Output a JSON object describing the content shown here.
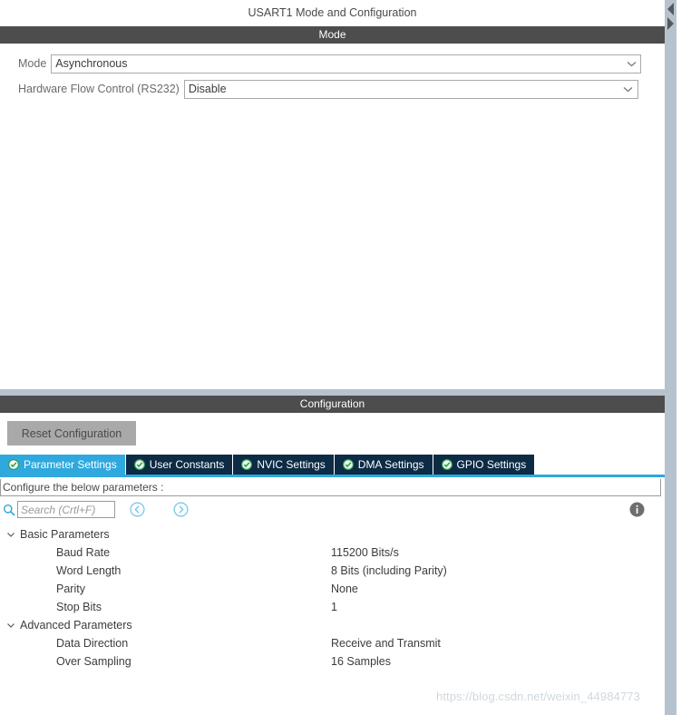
{
  "window": {
    "title": "USART1 Mode and Configuration"
  },
  "mode_section": {
    "header": "Mode",
    "fields": [
      {
        "label": "Mode",
        "value": "Asynchronous",
        "icon": "chevron-down-icon"
      },
      {
        "label": "Hardware Flow Control (RS232)",
        "value": "Disable",
        "icon": "chevron-down-icon"
      }
    ]
  },
  "configuration_section": {
    "header": "Configuration",
    "reset_button": "Reset Configuration",
    "tabs": [
      {
        "label": "Parameter Settings",
        "active": true,
        "icon": "green-check-icon"
      },
      {
        "label": "User Constants",
        "active": false,
        "icon": "green-check-icon"
      },
      {
        "label": "NVIC Settings",
        "active": false,
        "icon": "green-check-icon"
      },
      {
        "label": "DMA Settings",
        "active": false,
        "icon": "green-check-icon"
      },
      {
        "label": "GPIO Settings",
        "active": false,
        "icon": "green-check-icon"
      }
    ],
    "configure_label": "Configure the below parameters :",
    "search": {
      "placeholder": "Search (Crtl+F)",
      "value": "",
      "icon": "search-icon"
    },
    "nav": {
      "prev_icon": "circle-arrow-left-icon",
      "next_icon": "circle-arrow-right-icon"
    },
    "info_icon": "info-icon",
    "parameter_groups": [
      {
        "label": "Basic Parameters",
        "expanded": true,
        "icon": "chevron-down-icon",
        "rows": [
          {
            "label": "Baud Rate",
            "value": "115200 Bits/s"
          },
          {
            "label": "Word Length",
            "value": "8 Bits (including Parity)"
          },
          {
            "label": "Parity",
            "value": "None"
          },
          {
            "label": "Stop Bits",
            "value": "1"
          }
        ]
      },
      {
        "label": "Advanced Parameters",
        "expanded": true,
        "icon": "chevron-down-icon",
        "rows": [
          {
            "label": "Data Direction",
            "value": "Receive and Transmit"
          },
          {
            "label": "Over Sampling",
            "value": "16 Samples"
          }
        ]
      }
    ]
  },
  "splitter": {
    "collapse_icon": "triangle-left-icon",
    "expand_icon": "triangle-right-icon"
  },
  "watermark": {
    "text": "https://blog.csdn.net/weixin_44984773"
  },
  "colors": {
    "section_header_bg": "#4d4d4d",
    "tab_active_bg": "#2fa8dd",
    "tab_inactive_bg": "#0d2b45",
    "accent_blue": "#2fa8dd",
    "check_green": "#2e9e4f",
    "splitter_bg": "#b6c3ce",
    "reset_button_bg": "#a9a9a9"
  }
}
